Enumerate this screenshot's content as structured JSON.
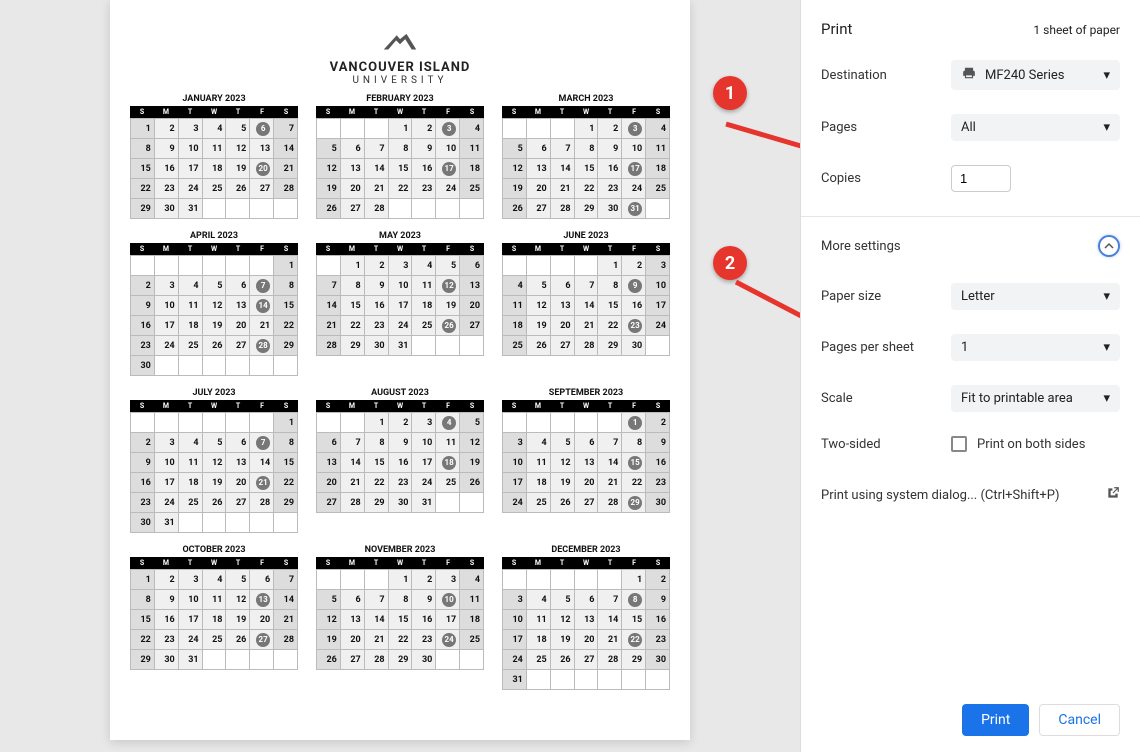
{
  "document": {
    "institution_name": "VANCOUVER ISLAND",
    "institution_sub": "UNIVERSITY",
    "days_of_week": [
      "S",
      "M",
      "T",
      "W",
      "T",
      "F",
      "S"
    ],
    "months": [
      {
        "name": "JANUARY 2023",
        "start": 0,
        "len": 31,
        "circles": [
          6,
          20
        ]
      },
      {
        "name": "FEBRUARY 2023",
        "start": 3,
        "len": 28,
        "circles": [
          3,
          17
        ]
      },
      {
        "name": "MARCH 2023",
        "start": 3,
        "len": 31,
        "circles": [
          3,
          17,
          31
        ]
      },
      {
        "name": "APRIL 2023",
        "start": 6,
        "len": 30,
        "circles": [
          7,
          14,
          28
        ]
      },
      {
        "name": "MAY 2023",
        "start": 1,
        "len": 31,
        "circles": [
          12,
          26
        ]
      },
      {
        "name": "JUNE 2023",
        "start": 4,
        "len": 30,
        "circles": [
          9,
          23
        ]
      },
      {
        "name": "JULY 2023",
        "start": 6,
        "len": 31,
        "circles": [
          7,
          21
        ]
      },
      {
        "name": "AUGUST 2023",
        "start": 2,
        "len": 31,
        "circles": [
          4,
          18
        ]
      },
      {
        "name": "SEPTEMBER 2023",
        "start": 5,
        "len": 30,
        "circles": [
          1,
          15,
          29
        ]
      },
      {
        "name": "OCTOBER 2023",
        "start": 0,
        "len": 31,
        "circles": [
          13,
          27
        ]
      },
      {
        "name": "NOVEMBER 2023",
        "start": 3,
        "len": 30,
        "circles": [
          10,
          24
        ]
      },
      {
        "name": "DECEMBER 2023",
        "start": 5,
        "len": 31,
        "circles": [
          8,
          22
        ]
      }
    ]
  },
  "print": {
    "title": "Print",
    "sheets_label": "1 sheet of paper",
    "destination_label": "Destination",
    "destination_value": "MF240 Series",
    "pages_label": "Pages",
    "pages_value": "All",
    "copies_label": "Copies",
    "copies_value": "1",
    "more_settings_label": "More settings",
    "paper_size_label": "Paper size",
    "paper_size_value": "Letter",
    "pps_label": "Pages per sheet",
    "pps_value": "1",
    "scale_label": "Scale",
    "scale_value": "Fit to printable area",
    "two_sided_label": "Two-sided",
    "two_sided_checkbox_label": "Print on both sides",
    "system_dialog_label": "Print using system dialog... (Ctrl+Shift+P)",
    "print_btn": "Print",
    "cancel_btn": "Cancel"
  },
  "annotations": {
    "step1": "1",
    "step2": "2"
  }
}
